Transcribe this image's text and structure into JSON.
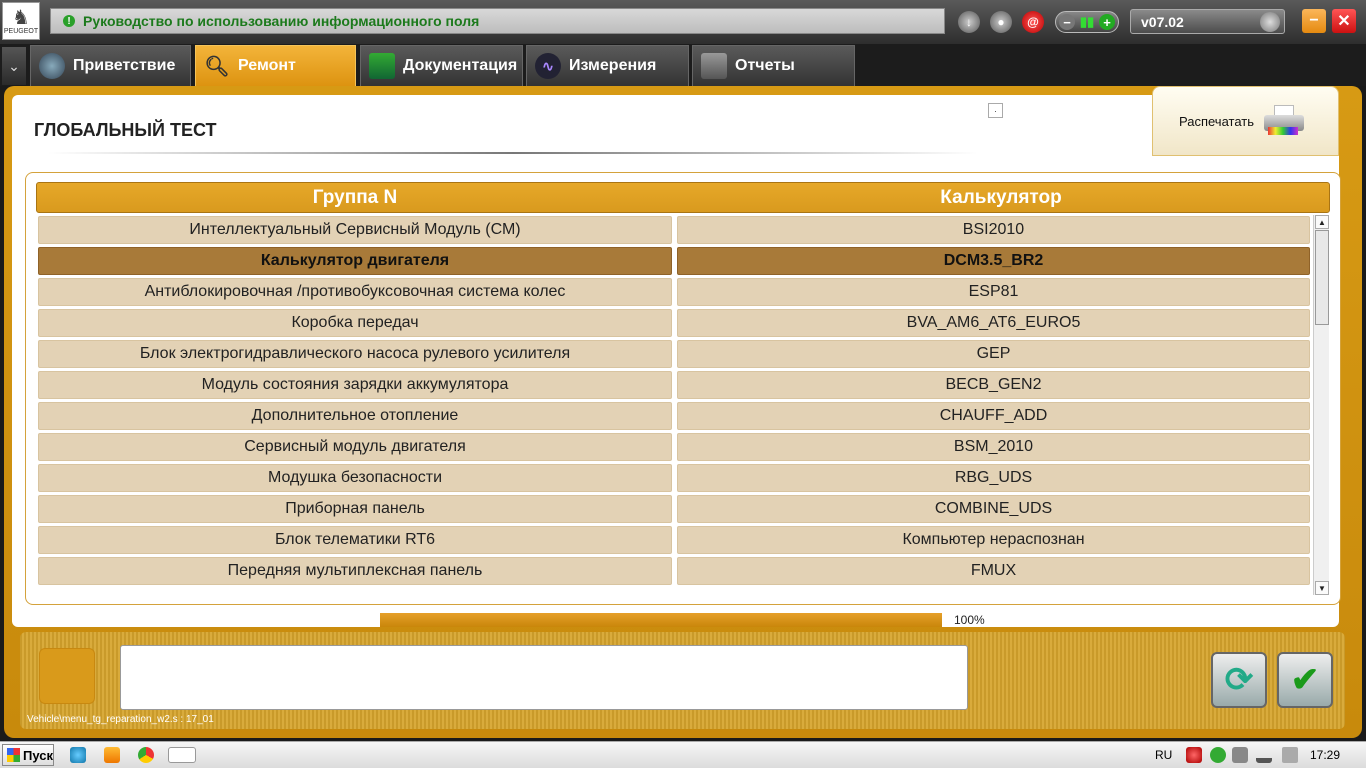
{
  "app": {
    "logo_text": "PEUGEOT",
    "info_text": "Руководство по использованию информационного поля",
    "version": "v07.02"
  },
  "tabs": [
    {
      "label": "Приветствие",
      "icon": "globe-icon",
      "active": false
    },
    {
      "label": "Ремонт",
      "icon": "magnifier-icon",
      "active": true
    },
    {
      "label": "Документация",
      "icon": "book-icon",
      "active": false
    },
    {
      "label": "Измерения",
      "icon": "waveform-icon",
      "active": false
    },
    {
      "label": "Отчеты",
      "icon": "report-icon",
      "active": false
    }
  ],
  "page": {
    "title": "ГЛОБАЛЬНЫЙ ТЕСТ",
    "print_label": "Распечатать"
  },
  "table": {
    "headers": [
      "Группа N",
      "Калькулятор"
    ],
    "rows": [
      {
        "group": "Интеллектуальный Сервисный Модуль (СМ)",
        "calc": "BSI2010",
        "selected": false
      },
      {
        "group": "Калькулятор двигателя",
        "calc": "DCM3.5_BR2",
        "selected": true
      },
      {
        "group": "Антиблокировочная /противобуксовочная система колес",
        "calc": "ESP81",
        "selected": false
      },
      {
        "group": "Коробка передач",
        "calc": "BVA_AM6_AT6_EURO5",
        "selected": false
      },
      {
        "group": "Блок электрогидравлического насоса рулевого усилителя",
        "calc": "GEP",
        "selected": false
      },
      {
        "group": "Модуль состояния зарядки аккумулятора",
        "calc": "BECB_GEN2",
        "selected": false
      },
      {
        "group": "Дополнительное отопление",
        "calc": "CHAUFF_ADD",
        "selected": false
      },
      {
        "group": "Сервисный модуль двигателя",
        "calc": "BSM_2010",
        "selected": false
      },
      {
        "group": "Модушка безопасности",
        "calc": "RBG_UDS",
        "selected": false
      },
      {
        "group": "Приборная панель",
        "calc": "COMBINE_UDS",
        "selected": false
      },
      {
        "group": "Блок телематики RT6",
        "calc": "Компьютер нераспознан",
        "selected": false
      },
      {
        "group": "Передняя мультиплексная панель",
        "calc": "FMUX",
        "selected": false
      }
    ]
  },
  "progress": {
    "value": 100,
    "label": "100%"
  },
  "bottom": {
    "path": "Vehicle\\menu_tg_reparation_w2.s : 17_01",
    "refresh_icon": "refresh-icon",
    "confirm_icon": "checkmark-icon"
  },
  "taskbar": {
    "start_label": "Пуск",
    "language": "RU",
    "clock": "17:29"
  },
  "colors": {
    "accent": "#D99A1E",
    "selected_row": "#A87A39",
    "row_bg": "#E3D2B5",
    "info_text": "#1C7A1C"
  }
}
